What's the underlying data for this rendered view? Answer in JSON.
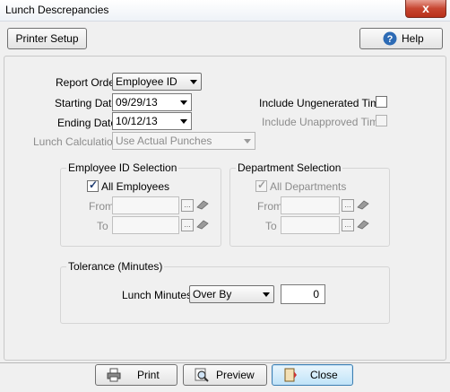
{
  "window": {
    "title": "Lunch Descrepancies",
    "close_glyph": "x"
  },
  "toolbar": {
    "printer_setup": "Printer Setup",
    "help": "Help"
  },
  "form": {
    "report_order_label": "Report Order",
    "report_order_value": "Employee ID",
    "starting_date_label": "Starting Date",
    "starting_date_value": "09/29/13",
    "ending_date_label": "Ending Date",
    "ending_date_value": "10/12/13",
    "lunch_calc_label": "Lunch Calculation",
    "lunch_calc_value": "Use Actual Punches",
    "include_ungenerated_label": "Include Ungenerated Time",
    "include_ungenerated_checked": false,
    "include_unapproved_label": "Include Unapproved Time",
    "include_unapproved_checked": false
  },
  "employee_selection": {
    "title": "Employee ID Selection",
    "all_label": "All Employees",
    "all_checked": true,
    "from_label": "From",
    "to_label": "To",
    "browse_glyph": "..."
  },
  "department_selection": {
    "title": "Department Selection",
    "all_label": "All Departments",
    "all_checked": true,
    "from_label": "From",
    "to_label": "To",
    "browse_glyph": "..."
  },
  "tolerance": {
    "title": "Tolerance (Minutes)",
    "lunch_minutes_label": "Lunch Minutes",
    "mode_value": "Over By",
    "minutes_value": "0"
  },
  "footer": {
    "print": "Print",
    "preview": "Preview",
    "close": "Close"
  },
  "colors": {
    "help_icon": "#2d6bb5",
    "close_focus": "#3c7fb1"
  }
}
